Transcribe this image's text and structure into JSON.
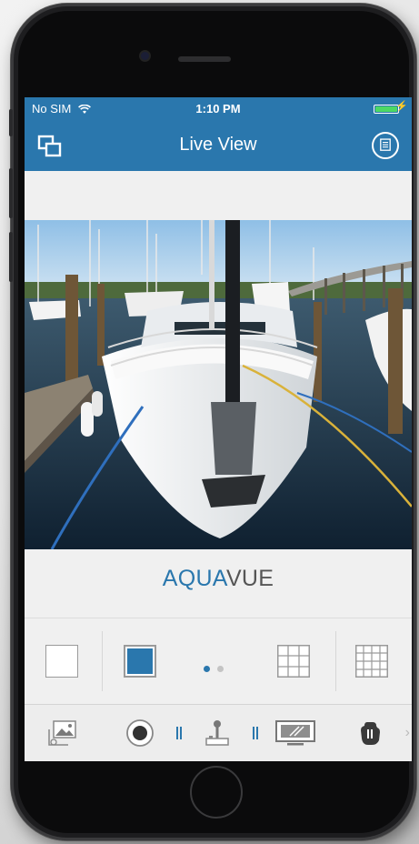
{
  "status_bar": {
    "carrier": "No SIM",
    "time": "1:10 PM",
    "battery_color": "#4cd964",
    "icons": [
      "wifi-icon",
      "battery-icon",
      "charging-icon"
    ]
  },
  "nav": {
    "title": "Live View",
    "left_icon": "multi-window-icon",
    "right_icon": "document-list-icon",
    "bar_color": "#2a77ad"
  },
  "video": {
    "description_icon": "camera-feed"
  },
  "brand": {
    "part1": "AQUA",
    "part2": "VUE",
    "part1_color": "#2a77ad",
    "part2_color": "#555555"
  },
  "layouts": {
    "items": [
      {
        "name": "single-view",
        "selected": false
      },
      {
        "name": "single-view-filled",
        "selected": true
      },
      {
        "name": "grid-3x3",
        "selected": false
      },
      {
        "name": "grid-4x4",
        "selected": false
      }
    ],
    "page_indicator": {
      "count": 2,
      "active": 0,
      "active_color": "#2a77ad",
      "inactive_color": "#c4c4c4"
    }
  },
  "toolbar": {
    "items": [
      "gallery-icon",
      "record-icon",
      "joystick-icon",
      "display-icon",
      "hand-icon"
    ],
    "more_glyph": "›"
  }
}
